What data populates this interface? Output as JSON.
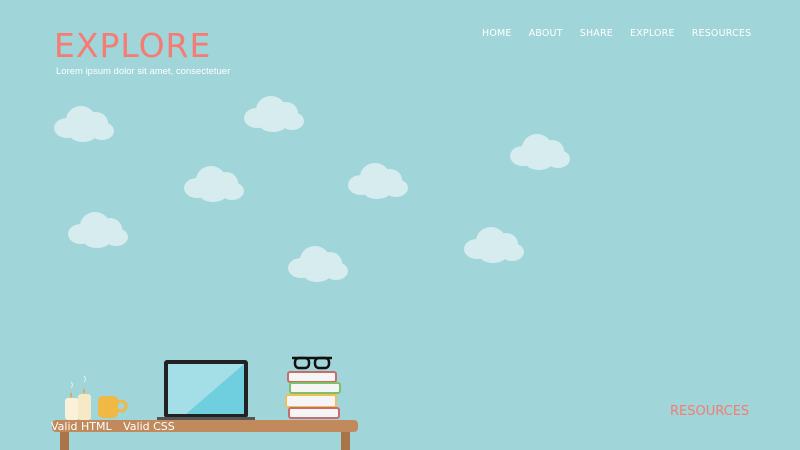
{
  "header": {
    "logo": "EXPLORE",
    "tagline": "Lorem ipsum dolor sit amet, consectetuer"
  },
  "nav": [
    "HOME",
    "ABOUT",
    "SHARE",
    "EXPLORE",
    "RESOURCES"
  ],
  "side_link": "RESOURCES",
  "footer": {
    "valid_html": "Valid HTML",
    "valid_css": "Valid CSS"
  },
  "colors": {
    "background": "#a0d5d9",
    "accent": "#f47c72",
    "cloud": "#d6ecee",
    "desk": "#c18a5c"
  }
}
